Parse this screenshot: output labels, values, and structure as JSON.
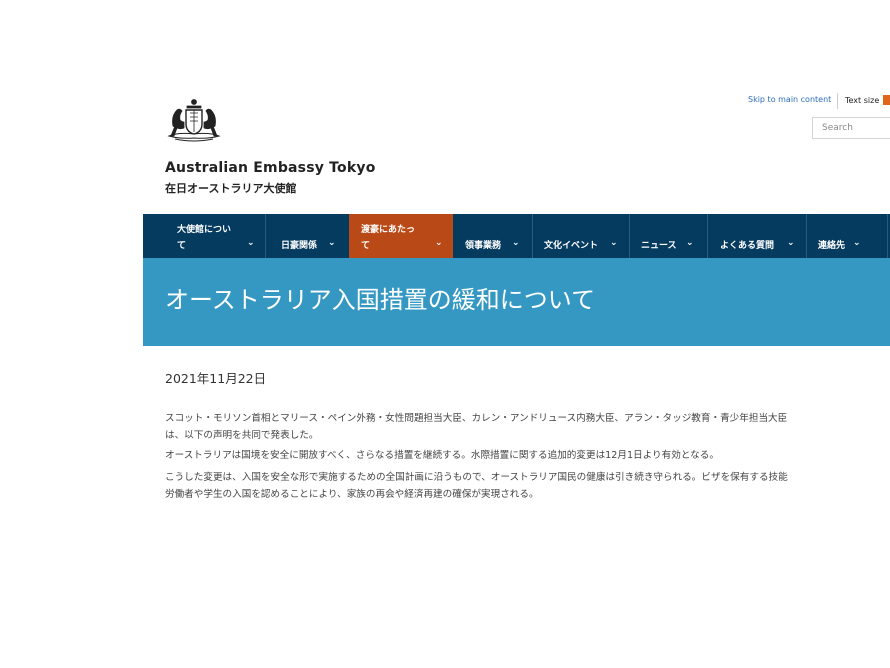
{
  "header": {
    "title": "Australian Embassy Tokyo",
    "subtitle": "在日オーストラリア大使館",
    "skip_link": "Skip to main content",
    "text_size_label": "Text size",
    "search_placeholder": "Search"
  },
  "nav": {
    "items": [
      {
        "label_line1": "大使館につい",
        "label_line2": "て"
      },
      {
        "label": "日豪関係"
      },
      {
        "label_line1": "渡豪にあたっ",
        "label_line2": "て"
      },
      {
        "label": "領事業務"
      },
      {
        "label": "文化イベント"
      },
      {
        "label": "ニュース"
      },
      {
        "label": "よくある質問"
      },
      {
        "label": "連絡先"
      }
    ],
    "active_index": 2
  },
  "page": {
    "title": "オーストラリア入国措置の緩和について",
    "date": "2021年11月22日",
    "paragraphs": [
      "スコット・モリソン首相とマリース・ペイン外務・女性問題担当大臣、カレン・アンドリュース内務大臣、アラン・タッジ教育・青少年担当大臣は、以下の声明を共同で発表した。",
      "オーストラリアは国境を安全に開放すべく、さらなる措置を継続する。水際措置に関する追加的変更は12月1日より有効となる。",
      "こうした変更は、入国を安全な形で実施するための全国計画に沿うもので、オーストラリア国民の健康は引き続き守られる。ビザを保有する技能労働者や学生の入国を認めることにより、家族の再会や経済再建の確保が実現される。"
    ]
  },
  "colors": {
    "nav_bg": "#063b60",
    "nav_active": "#b94a18",
    "banner_bg": "#3498c3",
    "link": "#2a6ebb",
    "accent": "#e0661c"
  },
  "icons": [
    "coat-of-arms-icon",
    "chevron-down-icon"
  ]
}
